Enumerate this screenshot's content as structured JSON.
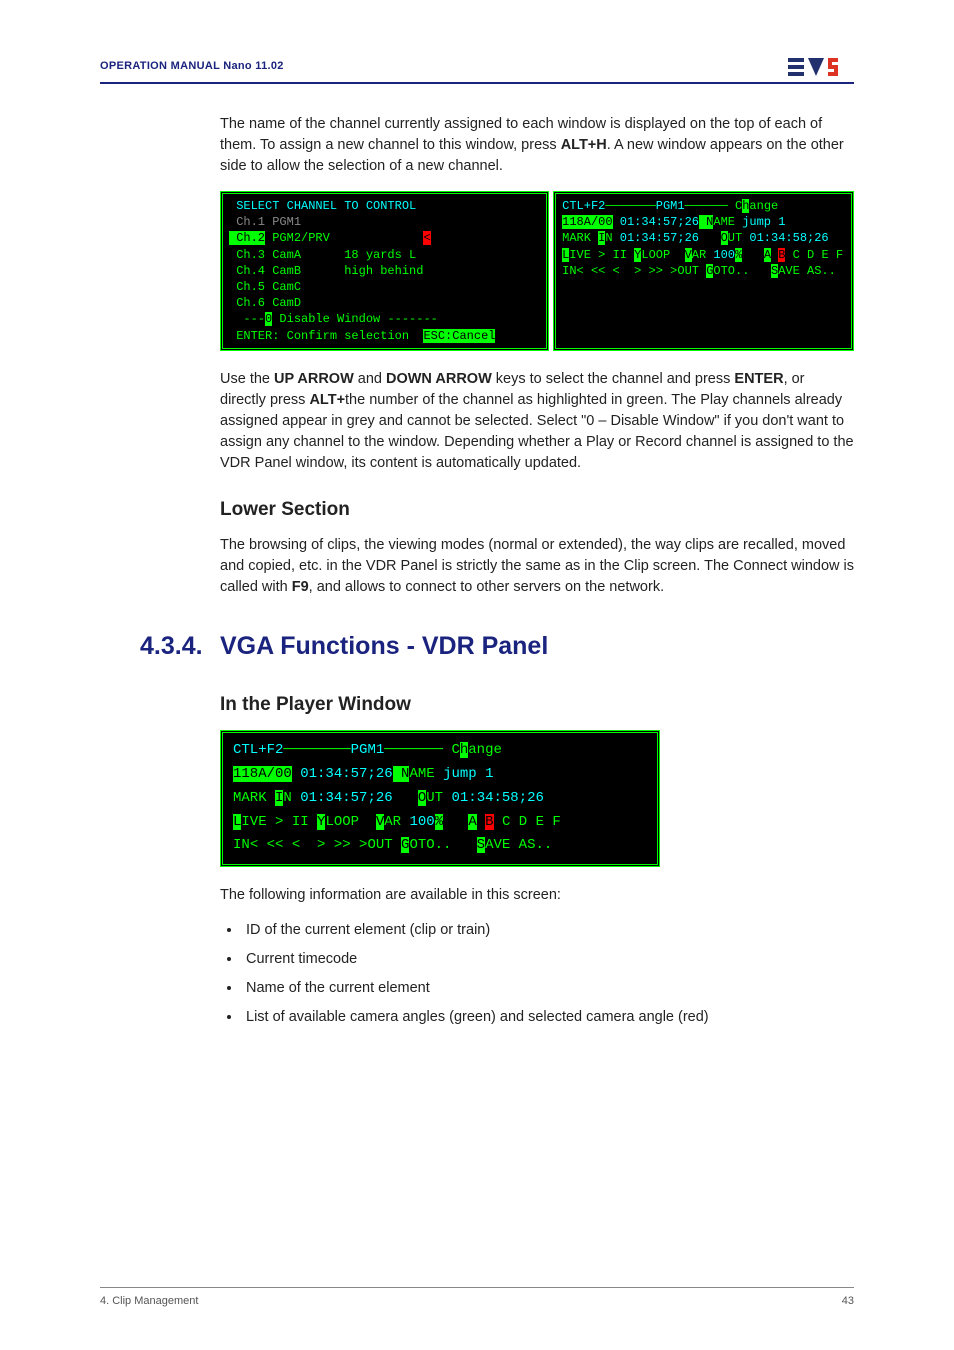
{
  "header": {
    "title": "OPERATION MANUAL Nano 11.02",
    "logo_alt": "EVS"
  },
  "para1_a": "The name of the channel currently assigned to each window is displayed on the top of each of them. To assign a new channel to this window, press ",
  "para1_key": "ALT+H",
  "para1_b": ". A new window appears on the other side to allow the selection of a new channel.",
  "term_left": {
    "title": " SELECT CHANNEL TO CONTROL ",
    "l1_a": " Ch.1",
    "l1_b": " PGM1",
    "l2_a": " Ch.2",
    "l2_b": " PGM2/PRV",
    "l2_cursor": "<",
    "l3_a": " Ch.3",
    "l3_b": " CamA      18 yards L",
    "l4_a": " Ch.4",
    "l4_b": " CamB      high behind",
    "l5_a": " Ch.5",
    "l5_b": " CamC",
    "l6_a": " Ch.6",
    "l6_b": " CamD",
    "l7_a": "  ---",
    "l7_b": "0",
    "l7_c": " Disable Window -------",
    "l8_a": " ENTER",
    "l8_b": ": Confirm selection  ",
    "l8_c": "ESC:Cancel"
  },
  "term_right": {
    "hdr_l": "CTL+F2",
    "hdr_m": "PGM1",
    "hdr_r_a": "C",
    "hdr_r_b": "h",
    "hdr_r_c": "ange",
    "r1_a": "118A/00",
    "r1_b": "01:34:57;26",
    "r1_c": " N",
    "r1_d": "AME ",
    "r1_e": "jump 1",
    "r2_a": "MARK ",
    "r2_b": "I",
    "r2_c": "N ",
    "r2_d": "01:34:57;26",
    "r2_e": "   ",
    "r2_f": "O",
    "r2_g": "UT ",
    "r2_h": "01:34:58;26",
    "r3_a": "L",
    "r3_b": "IVE > ",
    "r3_c": "II ",
    "r3_d": "Y",
    "r3_e": "LOOP  ",
    "r3_f": "V",
    "r3_g": "AR ",
    "r3_h": "100",
    "r3_i": "%",
    "r3_j": "   ",
    "r3_k": "A",
    "r3_l": " ",
    "r3_m": "B",
    "r3_n": " C D E F",
    "r4_a": "IN",
    "r4_b": "< << <  > >> >",
    "r4_c": "OUT ",
    "r4_d": "G",
    "r4_e": "OTO..   ",
    "r4_f": "S",
    "r4_g": "AVE AS.."
  },
  "para2_a": "Use the ",
  "para2_key1": "UP ARROW",
  "para2_b": " and ",
  "para2_key2": "DOWN ARROW",
  "para2_c": " keys to select the channel and press ",
  "para2_key3": "ENTER",
  "para2_d": ", or directly press ",
  "para2_key4": "ALT+",
  "para2_e": "the number of the channel as highlighted in green. The Play channels already assigned appear in grey and cannot be selected. Select \"0 – Disable Window\" if you don't want to assign any channel to the window. Depending whether a Play or Record channel is assigned to the VDR Panel window, its content is automatically updated.",
  "h2_lower": "Lower Section",
  "para3_a": "The browsing of clips, the viewing modes (normal or extended), the way clips are recalled, moved and copied, etc. in the VDR Panel is strictly the same as in the Clip screen. The Connect window is called with ",
  "para3_key": "F9",
  "para3_b": ", and allows to connect to other servers on the network.",
  "section_num": "4.3.4.",
  "section_title": "VGA Functions - VDR Panel",
  "h2_player": "In the Player Window",
  "para4": "The following information are available in this screen:",
  "bullets": [
    "ID of the current element (clip or train)",
    "Current timecode",
    "Name of the current element",
    "List of available camera angles (green) and selected camera angle (red)"
  ],
  "footer_left": "4. Clip Management",
  "footer_right": "43"
}
